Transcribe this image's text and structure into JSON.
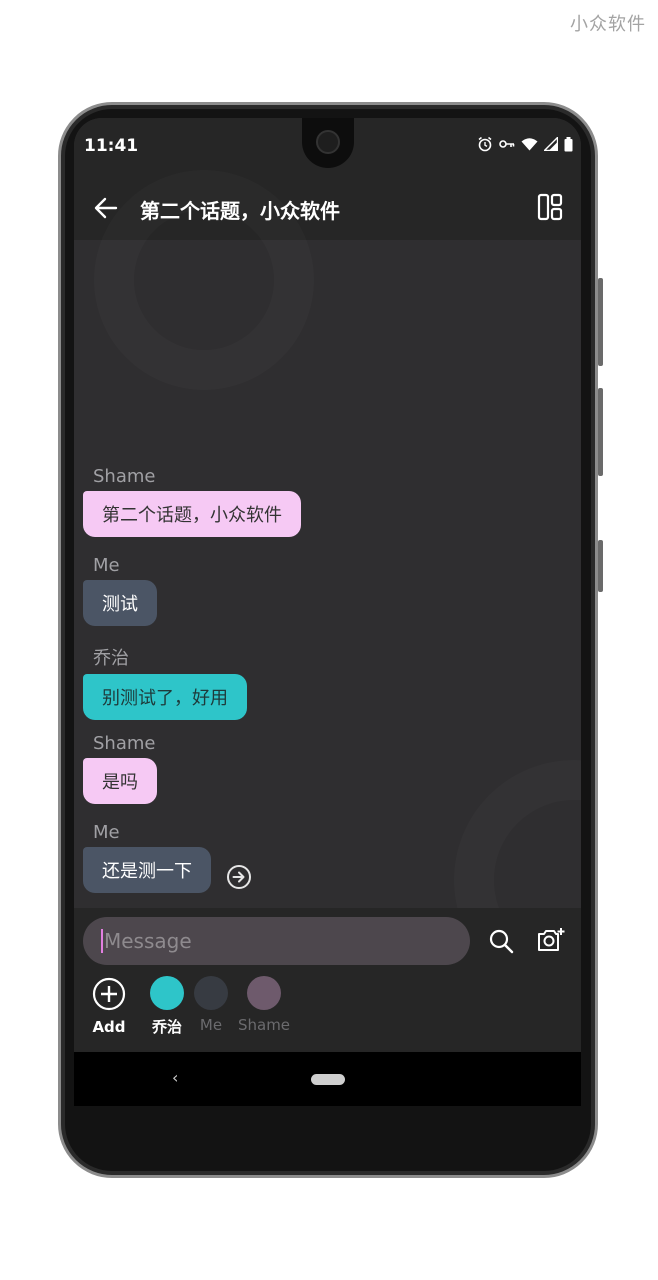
{
  "watermark": "小众软件",
  "status": {
    "time": "11:41",
    "icons": [
      "alarm-icon",
      "key-icon",
      "wifi-icon",
      "signal-icon",
      "battery-icon"
    ]
  },
  "appbar": {
    "title": "第二个话题，小众软件",
    "back_icon": "arrow-left-icon",
    "layout_icon": "layout-icon"
  },
  "messages": [
    {
      "sender": "Shame",
      "text": "第二个话题，小众软件"
    },
    {
      "sender": "Me",
      "text": "测试"
    },
    {
      "sender": "乔治",
      "text": "别测试了，好用"
    },
    {
      "sender": "Shame",
      "text": "是吗"
    },
    {
      "sender": "Me",
      "text": "还是测一下"
    }
  ],
  "composer": {
    "placeholder": "Message"
  },
  "people": [
    {
      "name": "Add"
    },
    {
      "name": "乔治",
      "color": "#2ec5c9"
    },
    {
      "name": "Me",
      "color": "#373b42"
    },
    {
      "name": "Shame",
      "color": "#6e5a6c"
    }
  ],
  "colors": {
    "shame_bubble": "#f6c9f4",
    "me_bubble": "#4b5565",
    "qiaozhi_bubble": "#2ec5c9",
    "accent_caret": "#e27fe0"
  }
}
